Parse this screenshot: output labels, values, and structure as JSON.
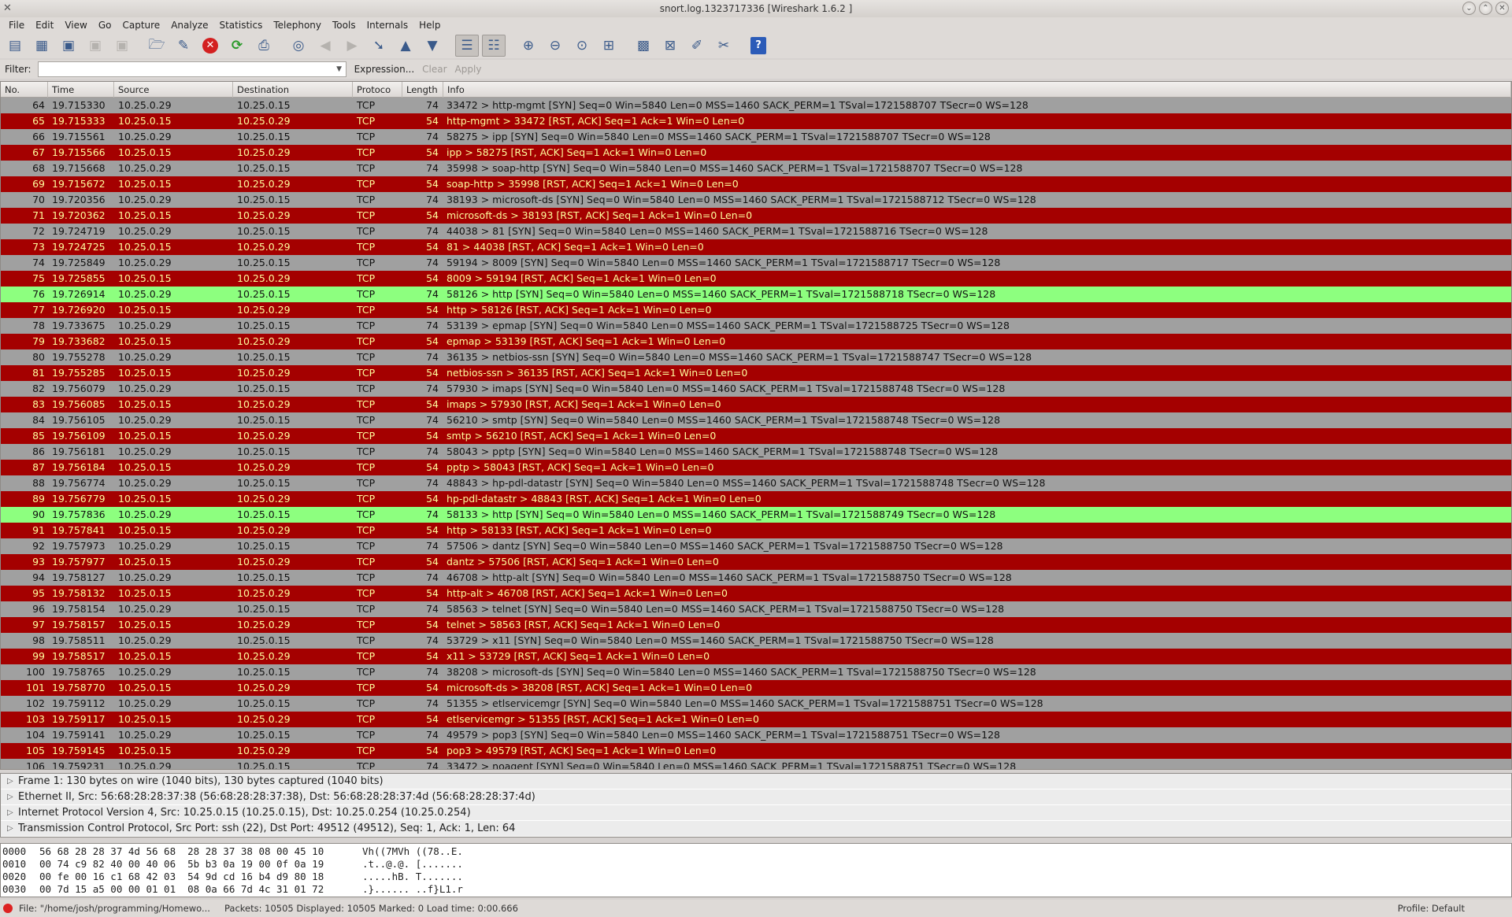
{
  "window": {
    "title": "snort.log.1323717336  [Wireshark 1.6.2 ]"
  },
  "menu": [
    "File",
    "Edit",
    "View",
    "Go",
    "Capture",
    "Analyze",
    "Statistics",
    "Telephony",
    "Tools",
    "Internals",
    "Help"
  ],
  "filter": {
    "label": "Filter:",
    "value": "",
    "expression": "Expression...",
    "clear": "Clear",
    "apply": "Apply"
  },
  "columns": [
    "No.",
    "Time",
    "Source",
    "Destination",
    "Protoco",
    "Length",
    "Info"
  ],
  "packets": [
    {
      "no": "64",
      "time": "19.715330",
      "src": "10.25.0.29",
      "dst": "10.25.0.15",
      "proto": "TCP",
      "len": "74",
      "info": "33472 > http-mgmt [SYN] Seq=0 Win=5840 Len=0 MSS=1460 SACK_PERM=1 TSval=1721588707 TSecr=0 WS=128",
      "kind": "syn"
    },
    {
      "no": "65",
      "time": "19.715333",
      "src": "10.25.0.15",
      "dst": "10.25.0.29",
      "proto": "TCP",
      "len": "54",
      "info": "http-mgmt > 33472 [RST, ACK] Seq=1 Ack=1 Win=0 Len=0",
      "kind": "rst"
    },
    {
      "no": "66",
      "time": "19.715561",
      "src": "10.25.0.29",
      "dst": "10.25.0.15",
      "proto": "TCP",
      "len": "74",
      "info": "58275 > ipp [SYN] Seq=0 Win=5840 Len=0 MSS=1460 SACK_PERM=1 TSval=1721588707 TSecr=0 WS=128",
      "kind": "syn"
    },
    {
      "no": "67",
      "time": "19.715566",
      "src": "10.25.0.15",
      "dst": "10.25.0.29",
      "proto": "TCP",
      "len": "54",
      "info": "ipp > 58275 [RST, ACK] Seq=1 Ack=1 Win=0 Len=0",
      "kind": "rst"
    },
    {
      "no": "68",
      "time": "19.715668",
      "src": "10.25.0.29",
      "dst": "10.25.0.15",
      "proto": "TCP",
      "len": "74",
      "info": "35998 > soap-http [SYN] Seq=0 Win=5840 Len=0 MSS=1460 SACK_PERM=1 TSval=1721588707 TSecr=0 WS=128",
      "kind": "syn"
    },
    {
      "no": "69",
      "time": "19.715672",
      "src": "10.25.0.15",
      "dst": "10.25.0.29",
      "proto": "TCP",
      "len": "54",
      "info": "soap-http > 35998 [RST, ACK] Seq=1 Ack=1 Win=0 Len=0",
      "kind": "rst"
    },
    {
      "no": "70",
      "time": "19.720356",
      "src": "10.25.0.29",
      "dst": "10.25.0.15",
      "proto": "TCP",
      "len": "74",
      "info": "38193 > microsoft-ds [SYN] Seq=0 Win=5840 Len=0 MSS=1460 SACK_PERM=1 TSval=1721588712 TSecr=0 WS=128",
      "kind": "syn"
    },
    {
      "no": "71",
      "time": "19.720362",
      "src": "10.25.0.15",
      "dst": "10.25.0.29",
      "proto": "TCP",
      "len": "54",
      "info": "microsoft-ds > 38193 [RST, ACK] Seq=1 Ack=1 Win=0 Len=0",
      "kind": "rst"
    },
    {
      "no": "72",
      "time": "19.724719",
      "src": "10.25.0.29",
      "dst": "10.25.0.15",
      "proto": "TCP",
      "len": "74",
      "info": "44038 > 81 [SYN] Seq=0 Win=5840 Len=0 MSS=1460 SACK_PERM=1 TSval=1721588716 TSecr=0 WS=128",
      "kind": "syn"
    },
    {
      "no": "73",
      "time": "19.724725",
      "src": "10.25.0.15",
      "dst": "10.25.0.29",
      "proto": "TCP",
      "len": "54",
      "info": "81 > 44038 [RST, ACK] Seq=1 Ack=1 Win=0 Len=0",
      "kind": "rst"
    },
    {
      "no": "74",
      "time": "19.725849",
      "src": "10.25.0.29",
      "dst": "10.25.0.15",
      "proto": "TCP",
      "len": "74",
      "info": "59194 > 8009 [SYN] Seq=0 Win=5840 Len=0 MSS=1460 SACK_PERM=1 TSval=1721588717 TSecr=0 WS=128",
      "kind": "syn"
    },
    {
      "no": "75",
      "time": "19.725855",
      "src": "10.25.0.15",
      "dst": "10.25.0.29",
      "proto": "TCP",
      "len": "54",
      "info": "8009 > 59194 [RST, ACK] Seq=1 Ack=1 Win=0 Len=0",
      "kind": "rst"
    },
    {
      "no": "76",
      "time": "19.726914",
      "src": "10.25.0.29",
      "dst": "10.25.0.15",
      "proto": "TCP",
      "len": "74",
      "info": "58126 > http [SYN] Seq=0 Win=5840 Len=0 MSS=1460 SACK_PERM=1 TSval=1721588718 TSecr=0 WS=128",
      "kind": "http"
    },
    {
      "no": "77",
      "time": "19.726920",
      "src": "10.25.0.15",
      "dst": "10.25.0.29",
      "proto": "TCP",
      "len": "54",
      "info": "http > 58126 [RST, ACK] Seq=1 Ack=1 Win=0 Len=0",
      "kind": "rst"
    },
    {
      "no": "78",
      "time": "19.733675",
      "src": "10.25.0.29",
      "dst": "10.25.0.15",
      "proto": "TCP",
      "len": "74",
      "info": "53139 > epmap [SYN] Seq=0 Win=5840 Len=0 MSS=1460 SACK_PERM=1 TSval=1721588725 TSecr=0 WS=128",
      "kind": "syn"
    },
    {
      "no": "79",
      "time": "19.733682",
      "src": "10.25.0.15",
      "dst": "10.25.0.29",
      "proto": "TCP",
      "len": "54",
      "info": "epmap > 53139 [RST, ACK] Seq=1 Ack=1 Win=0 Len=0",
      "kind": "rst"
    },
    {
      "no": "80",
      "time": "19.755278",
      "src": "10.25.0.29",
      "dst": "10.25.0.15",
      "proto": "TCP",
      "len": "74",
      "info": "36135 > netbios-ssn [SYN] Seq=0 Win=5840 Len=0 MSS=1460 SACK_PERM=1 TSval=1721588747 TSecr=0 WS=128",
      "kind": "syn"
    },
    {
      "no": "81",
      "time": "19.755285",
      "src": "10.25.0.15",
      "dst": "10.25.0.29",
      "proto": "TCP",
      "len": "54",
      "info": "netbios-ssn > 36135 [RST, ACK] Seq=1 Ack=1 Win=0 Len=0",
      "kind": "rst"
    },
    {
      "no": "82",
      "time": "19.756079",
      "src": "10.25.0.29",
      "dst": "10.25.0.15",
      "proto": "TCP",
      "len": "74",
      "info": "57930 > imaps [SYN] Seq=0 Win=5840 Len=0 MSS=1460 SACK_PERM=1 TSval=1721588748 TSecr=0 WS=128",
      "kind": "syn"
    },
    {
      "no": "83",
      "time": "19.756085",
      "src": "10.25.0.15",
      "dst": "10.25.0.29",
      "proto": "TCP",
      "len": "54",
      "info": "imaps > 57930 [RST, ACK] Seq=1 Ack=1 Win=0 Len=0",
      "kind": "rst"
    },
    {
      "no": "84",
      "time": "19.756105",
      "src": "10.25.0.29",
      "dst": "10.25.0.15",
      "proto": "TCP",
      "len": "74",
      "info": "56210 > smtp [SYN] Seq=0 Win=5840 Len=0 MSS=1460 SACK_PERM=1 TSval=1721588748 TSecr=0 WS=128",
      "kind": "syn"
    },
    {
      "no": "85",
      "time": "19.756109",
      "src": "10.25.0.15",
      "dst": "10.25.0.29",
      "proto": "TCP",
      "len": "54",
      "info": "smtp > 56210 [RST, ACK] Seq=1 Ack=1 Win=0 Len=0",
      "kind": "rst"
    },
    {
      "no": "86",
      "time": "19.756181",
      "src": "10.25.0.29",
      "dst": "10.25.0.15",
      "proto": "TCP",
      "len": "74",
      "info": "58043 > pptp [SYN] Seq=0 Win=5840 Len=0 MSS=1460 SACK_PERM=1 TSval=1721588748 TSecr=0 WS=128",
      "kind": "syn"
    },
    {
      "no": "87",
      "time": "19.756184",
      "src": "10.25.0.15",
      "dst": "10.25.0.29",
      "proto": "TCP",
      "len": "54",
      "info": "pptp > 58043 [RST, ACK] Seq=1 Ack=1 Win=0 Len=0",
      "kind": "rst"
    },
    {
      "no": "88",
      "time": "19.756774",
      "src": "10.25.0.29",
      "dst": "10.25.0.15",
      "proto": "TCP",
      "len": "74",
      "info": "48843 > hp-pdl-datastr [SYN] Seq=0 Win=5840 Len=0 MSS=1460 SACK_PERM=1 TSval=1721588748 TSecr=0 WS=128",
      "kind": "syn"
    },
    {
      "no": "89",
      "time": "19.756779",
      "src": "10.25.0.15",
      "dst": "10.25.0.29",
      "proto": "TCP",
      "len": "54",
      "info": "hp-pdl-datastr > 48843 [RST, ACK] Seq=1 Ack=1 Win=0 Len=0",
      "kind": "rst"
    },
    {
      "no": "90",
      "time": "19.757836",
      "src": "10.25.0.29",
      "dst": "10.25.0.15",
      "proto": "TCP",
      "len": "74",
      "info": "58133 > http [SYN] Seq=0 Win=5840 Len=0 MSS=1460 SACK_PERM=1 TSval=1721588749 TSecr=0 WS=128",
      "kind": "http"
    },
    {
      "no": "91",
      "time": "19.757841",
      "src": "10.25.0.15",
      "dst": "10.25.0.29",
      "proto": "TCP",
      "len": "54",
      "info": "http > 58133 [RST, ACK] Seq=1 Ack=1 Win=0 Len=0",
      "kind": "rst"
    },
    {
      "no": "92",
      "time": "19.757973",
      "src": "10.25.0.29",
      "dst": "10.25.0.15",
      "proto": "TCP",
      "len": "74",
      "info": "57506 > dantz [SYN] Seq=0 Win=5840 Len=0 MSS=1460 SACK_PERM=1 TSval=1721588750 TSecr=0 WS=128",
      "kind": "syn"
    },
    {
      "no": "93",
      "time": "19.757977",
      "src": "10.25.0.15",
      "dst": "10.25.0.29",
      "proto": "TCP",
      "len": "54",
      "info": "dantz > 57506 [RST, ACK] Seq=1 Ack=1 Win=0 Len=0",
      "kind": "rst"
    },
    {
      "no": "94",
      "time": "19.758127",
      "src": "10.25.0.29",
      "dst": "10.25.0.15",
      "proto": "TCP",
      "len": "74",
      "info": "46708 > http-alt [SYN] Seq=0 Win=5840 Len=0 MSS=1460 SACK_PERM=1 TSval=1721588750 TSecr=0 WS=128",
      "kind": "syn"
    },
    {
      "no": "95",
      "time": "19.758132",
      "src": "10.25.0.15",
      "dst": "10.25.0.29",
      "proto": "TCP",
      "len": "54",
      "info": "http-alt > 46708 [RST, ACK] Seq=1 Ack=1 Win=0 Len=0",
      "kind": "rst"
    },
    {
      "no": "96",
      "time": "19.758154",
      "src": "10.25.0.29",
      "dst": "10.25.0.15",
      "proto": "TCP",
      "len": "74",
      "info": "58563 > telnet [SYN] Seq=0 Win=5840 Len=0 MSS=1460 SACK_PERM=1 TSval=1721588750 TSecr=0 WS=128",
      "kind": "syn"
    },
    {
      "no": "97",
      "time": "19.758157",
      "src": "10.25.0.15",
      "dst": "10.25.0.29",
      "proto": "TCP",
      "len": "54",
      "info": "telnet > 58563 [RST, ACK] Seq=1 Ack=1 Win=0 Len=0",
      "kind": "rst"
    },
    {
      "no": "98",
      "time": "19.758511",
      "src": "10.25.0.29",
      "dst": "10.25.0.15",
      "proto": "TCP",
      "len": "74",
      "info": "53729 > x11 [SYN] Seq=0 Win=5840 Len=0 MSS=1460 SACK_PERM=1 TSval=1721588750 TSecr=0 WS=128",
      "kind": "syn"
    },
    {
      "no": "99",
      "time": "19.758517",
      "src": "10.25.0.15",
      "dst": "10.25.0.29",
      "proto": "TCP",
      "len": "54",
      "info": "x11 > 53729 [RST, ACK] Seq=1 Ack=1 Win=0 Len=0",
      "kind": "rst"
    },
    {
      "no": "100",
      "time": "19.758765",
      "src": "10.25.0.29",
      "dst": "10.25.0.15",
      "proto": "TCP",
      "len": "74",
      "info": "38208 > microsoft-ds [SYN] Seq=0 Win=5840 Len=0 MSS=1460 SACK_PERM=1 TSval=1721588750 TSecr=0 WS=128",
      "kind": "syn"
    },
    {
      "no": "101",
      "time": "19.758770",
      "src": "10.25.0.15",
      "dst": "10.25.0.29",
      "proto": "TCP",
      "len": "54",
      "info": "microsoft-ds > 38208 [RST, ACK] Seq=1 Ack=1 Win=0 Len=0",
      "kind": "rst"
    },
    {
      "no": "102",
      "time": "19.759112",
      "src": "10.25.0.29",
      "dst": "10.25.0.15",
      "proto": "TCP",
      "len": "74",
      "info": "51355 > etlservicemgr [SYN] Seq=0 Win=5840 Len=0 MSS=1460 SACK_PERM=1 TSval=1721588751 TSecr=0 WS=128",
      "kind": "syn"
    },
    {
      "no": "103",
      "time": "19.759117",
      "src": "10.25.0.15",
      "dst": "10.25.0.29",
      "proto": "TCP",
      "len": "54",
      "info": "etlservicemgr > 51355 [RST, ACK] Seq=1 Ack=1 Win=0 Len=0",
      "kind": "rst"
    },
    {
      "no": "104",
      "time": "19.759141",
      "src": "10.25.0.29",
      "dst": "10.25.0.15",
      "proto": "TCP",
      "len": "74",
      "info": "49579 > pop3 [SYN] Seq=0 Win=5840 Len=0 MSS=1460 SACK_PERM=1 TSval=1721588751 TSecr=0 WS=128",
      "kind": "syn"
    },
    {
      "no": "105",
      "time": "19.759145",
      "src": "10.25.0.15",
      "dst": "10.25.0.29",
      "proto": "TCP",
      "len": "54",
      "info": "pop3 > 49579 [RST, ACK] Seq=1 Ack=1 Win=0 Len=0",
      "kind": "rst"
    },
    {
      "no": "106",
      "time": "19.759231",
      "src": "10.25.0.29",
      "dst": "10.25.0.15",
      "proto": "TCP",
      "len": "74",
      "info": "33472 > noagent [SYN] Seq=0 Win=5840 Len=0 MSS=1460 SACK_PERM=1 TSval=1721588751 TSecr=0 WS=128",
      "kind": "syn"
    }
  ],
  "details": [
    "Frame 1: 130 bytes on wire (1040 bits), 130 bytes captured (1040 bits)",
    "Ethernet II, Src: 56:68:28:28:37:38 (56:68:28:28:37:38), Dst: 56:68:28:28:37:4d (56:68:28:28:37:4d)",
    "Internet Protocol Version 4, Src: 10.25.0.15 (10.25.0.15), Dst: 10.25.0.254 (10.25.0.254)",
    "Transmission Control Protocol, Src Port: ssh (22), Dst Port: 49512 (49512), Seq: 1, Ack: 1, Len: 64"
  ],
  "bytes": [
    {
      "off": "0000",
      "hex": "56 68 28 28 37 4d 56 68  28 28 37 38 08 00 45 10",
      "ascii": "Vh((7MVh ((78..E."
    },
    {
      "off": "0010",
      "hex": "00 74 c9 82 40 00 40 06  5b b3 0a 19 00 0f 0a 19",
      "ascii": ".t..@.@. [......."
    },
    {
      "off": "0020",
      "hex": "00 fe 00 16 c1 68 42 03  54 9d cd 16 b4 d9 80 18",
      "ascii": ".....hB. T......."
    },
    {
      "off": "0030",
      "hex": "00 7d 15 a5 00 00 01 01  08 0a 66 7d 4c 31 01 72",
      "ascii": ".}...... ..f}L1.r"
    }
  ],
  "status": {
    "file": "File: \"/home/josh/programming/Homewo...",
    "packets": "Packets: 10505 Displayed: 10505 Marked: 0 Load time: 0:00.666",
    "profile": "Profile: Default"
  },
  "colors": {
    "syn_row": "#a0a0a0",
    "rst_row": "#a40000",
    "rst_text": "#fffc9c",
    "http_row": "#8dff7f"
  }
}
